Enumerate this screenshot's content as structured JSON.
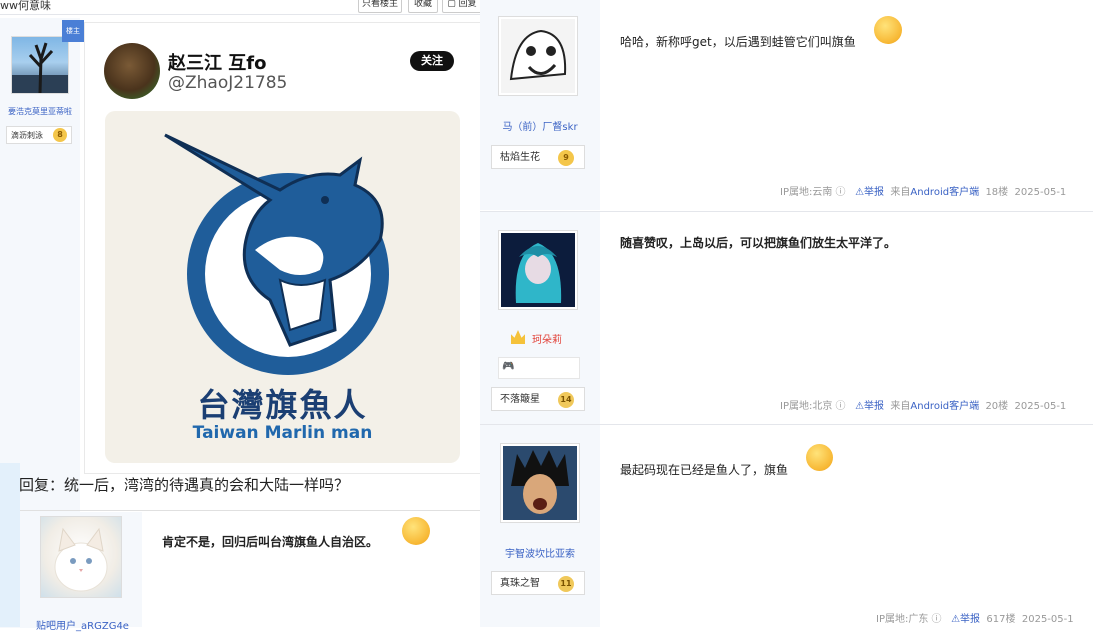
{
  "left": {
    "top_title": "ww何意味",
    "top_buttons": [
      "只看楼主",
      "收藏",
      "回复"
    ],
    "corner_tag": "楼主",
    "user": {
      "name": "要浩克莫里亚蒂啦",
      "badge": "滴沥刺泳",
      "level": "8"
    },
    "tweet": {
      "name": "赵三江 互fo",
      "handle": "@ZhaoJ21785",
      "follow": "关注",
      "logo_cn": "台灣旗魚人",
      "logo_en": "Taiwan Marlin man"
    },
    "reply_text": "回复：统一后，湾湾的待遇真的会和大陆一样吗？",
    "sub_user": {
      "name": "贴吧用户_aRGZG4e"
    },
    "sub_post": "肯定不是，回归后叫台湾旗鱼人自治区。"
  },
  "right": {
    "posts": [
      {
        "user": "马（前）厂督skr",
        "badge": "枯焰生花",
        "level": "9",
        "text": "哈哈，新称呼get，以后遇到蛙管它们叫旗鱼",
        "ip": "IP属地:云南",
        "report": "举报",
        "client_prefix": "来自",
        "client": "Android客户端",
        "floor": "18楼",
        "date": "2025-05-1"
      },
      {
        "user": "珂朵莉",
        "badge": "不落簸星",
        "level": "14",
        "text": "随喜赞叹，上岛以后，可以把旗鱼们放生太平洋了。",
        "ip": "IP属地:北京",
        "report": "举报",
        "client_prefix": "来自",
        "client": "Android客户端",
        "floor": "20楼",
        "date": "2025-05-1"
      },
      {
        "user": "宇智波坎比亚索",
        "badge": "真珠之智",
        "level": "11",
        "text": "最起码现在已经是鱼人了，旗鱼",
        "ip": "IP属地:广东",
        "report": "举报",
        "floor": "617楼",
        "date": "2025-05-1"
      }
    ]
  },
  "colors": {
    "link": "#3a62c4",
    "meta": "#999999",
    "user_col_bg": "#f5f8fc",
    "marlin_blue": "#1f5d9a"
  }
}
